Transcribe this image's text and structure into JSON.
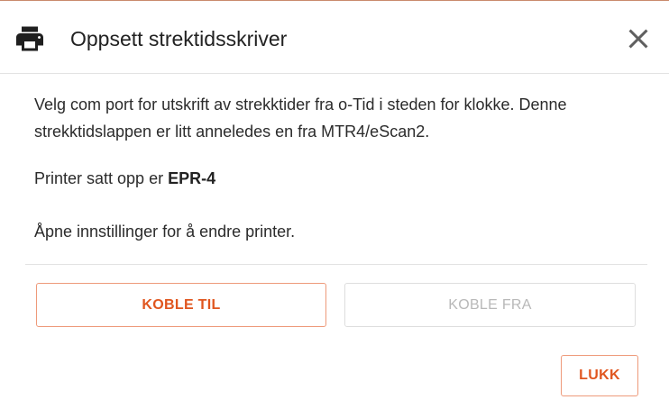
{
  "dialog": {
    "title": "Oppsett strektidsskriver",
    "header_icon": "printer-icon",
    "close_icon": "close-icon"
  },
  "body": {
    "description": "Velg com port for utskrift av strekktider fra o-Tid i steden for klokke. Denne strekktidslappen er litt anneledes en fra MTR4/eScan2.",
    "printer_prefix": "Printer satt opp er ",
    "printer_name": "EPR-4",
    "settings_hint": "Åpne innstillinger for å endre printer."
  },
  "buttons": {
    "connect_label": "KOBLE TIL",
    "disconnect_label": "KOBLE FRA",
    "disconnect_enabled": false,
    "close_label": "LUKK"
  },
  "colors": {
    "accent": "#e0561f",
    "accent_border": "#ee9a7a",
    "disabled_text": "#b8b8b8"
  }
}
